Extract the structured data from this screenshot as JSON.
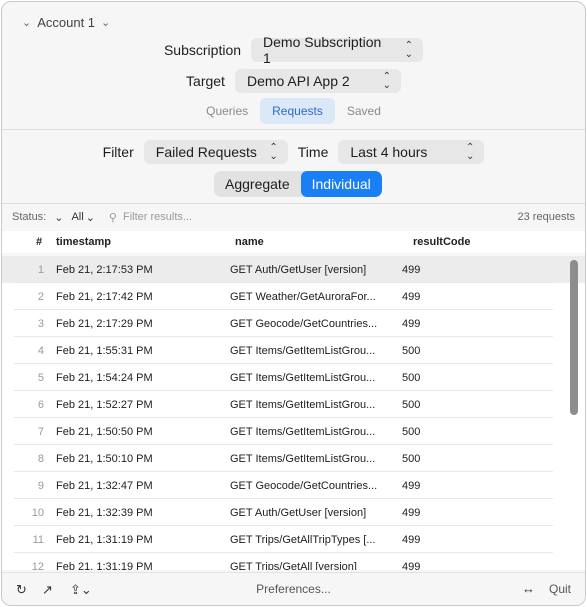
{
  "account": {
    "label": "Account 1"
  },
  "subscription": {
    "label": "Subscription",
    "value": "Demo Subscription 1"
  },
  "target": {
    "label": "Target",
    "value": "Demo API App 2"
  },
  "mode_tabs": [
    {
      "label": "Queries",
      "active": false
    },
    {
      "label": "Requests",
      "active": true
    },
    {
      "label": "Saved",
      "active": false
    }
  ],
  "filter": {
    "label": "Filter",
    "value": "Failed Requests"
  },
  "time": {
    "label": "Time",
    "value": "Last 4 hours"
  },
  "view_toggle": [
    {
      "label": "Aggregate",
      "active": false
    },
    {
      "label": "Individual",
      "active": true
    }
  ],
  "status_filter": {
    "label": "Status:",
    "value": "All",
    "search_placeholder": "Filter results...",
    "count": "23 requests"
  },
  "table": {
    "headers": {
      "num": "#",
      "timestamp": "timestamp",
      "name": "name",
      "resultCode": "resultCode"
    },
    "rows": [
      {
        "num": "1",
        "timestamp": "Feb 21, 2:17:53 PM",
        "name": "GET Auth/GetUser [version]",
        "resultCode": "499"
      },
      {
        "num": "2",
        "timestamp": "Feb 21, 2:17:42 PM",
        "name": "GET Weather/GetAuroraFor...",
        "resultCode": "499"
      },
      {
        "num": "3",
        "timestamp": "Feb 21, 2:17:29 PM",
        "name": "GET Geocode/GetCountries...",
        "resultCode": "499"
      },
      {
        "num": "4",
        "timestamp": "Feb 21, 1:55:31 PM",
        "name": "GET Items/GetItemListGrou...",
        "resultCode": "500"
      },
      {
        "num": "5",
        "timestamp": "Feb 21, 1:54:24 PM",
        "name": "GET Items/GetItemListGrou...",
        "resultCode": "500"
      },
      {
        "num": "6",
        "timestamp": "Feb 21, 1:52:27 PM",
        "name": "GET Items/GetItemListGrou...",
        "resultCode": "500"
      },
      {
        "num": "7",
        "timestamp": "Feb 21, 1:50:50 PM",
        "name": "GET Items/GetItemListGrou...",
        "resultCode": "500"
      },
      {
        "num": "8",
        "timestamp": "Feb 21, 1:50:10 PM",
        "name": "GET Items/GetItemListGrou...",
        "resultCode": "500"
      },
      {
        "num": "9",
        "timestamp": "Feb 21, 1:32:47 PM",
        "name": "GET Geocode/GetCountries...",
        "resultCode": "499"
      },
      {
        "num": "10",
        "timestamp": "Feb 21, 1:32:39 PM",
        "name": "GET Auth/GetUser [version]",
        "resultCode": "499"
      },
      {
        "num": "11",
        "timestamp": "Feb 21, 1:31:19 PM",
        "name": "GET Trips/GetAllTripTypes [...",
        "resultCode": "499"
      },
      {
        "num": "12",
        "timestamp": "Feb 21, 1:31:19 PM",
        "name": "GET Trips/GetAll [version]",
        "resultCode": "499"
      }
    ]
  },
  "footer": {
    "preferences": "Preferences...",
    "quit": "Quit"
  },
  "colors": {
    "accent": "#1a7ef5",
    "tab_active_bg": "#dbe8f7",
    "tab_active_text": "#2a6ad3"
  }
}
